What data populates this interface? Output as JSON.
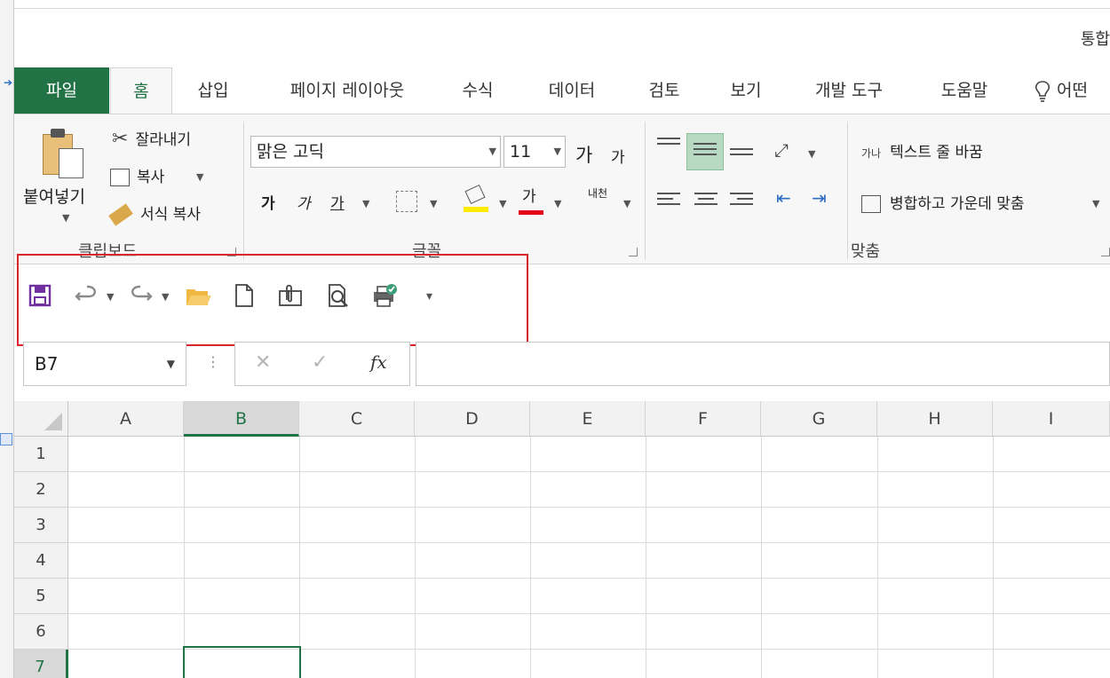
{
  "window": {
    "title_partial": "통합"
  },
  "tabs": [
    {
      "label": "파일"
    },
    {
      "label": "홈"
    },
    {
      "label": "삽입"
    },
    {
      "label": "페이지 레이아웃"
    },
    {
      "label": "수식"
    },
    {
      "label": "데이터"
    },
    {
      "label": "검토"
    },
    {
      "label": "보기"
    },
    {
      "label": "개발 도구"
    },
    {
      "label": "도움말"
    },
    {
      "label": "어떤"
    }
  ],
  "clipboard": {
    "paste": "붙여넣기",
    "cut": "잘라내기",
    "copy": "복사",
    "format_painter": "서식 복사",
    "group_label": "클립보드"
  },
  "font": {
    "font_name": "맑은 고딕",
    "font_size": "11",
    "grow": "가",
    "shrink": "가",
    "bold": "가",
    "italic": "가",
    "underline": "가",
    "font_color_glyph": "가",
    "phonetic": "내천",
    "group_label": "글꼴"
  },
  "alignment": {
    "wrap_text": "텍스트 줄 바꿈",
    "wrap_icon_text": "가나",
    "merge_center": "병합하고 가운데 맞춤",
    "group_label": "맞춤"
  },
  "quick_access": {
    "icons": [
      "save-icon",
      "undo-icon",
      "redo-icon",
      "open-folder-icon",
      "new-document-icon",
      "attach-icon",
      "print-preview-icon",
      "quick-print-icon",
      "customize-toolbar-icon"
    ],
    "accent_color": "#d9232d"
  },
  "formula_bar": {
    "name_box": "B7",
    "cancel": "✕",
    "enter": "✓",
    "fx": "fx",
    "formula": ""
  },
  "sheet": {
    "columns": [
      "A",
      "B",
      "C",
      "D",
      "E",
      "F",
      "G",
      "H",
      "I"
    ],
    "rows": [
      "1",
      "2",
      "3",
      "4",
      "5",
      "6",
      "7"
    ],
    "selected_column": "B",
    "selected_row": "7",
    "active_cell": "B7"
  },
  "colors": {
    "brand": "#217346",
    "highlight": "#d9232d"
  }
}
